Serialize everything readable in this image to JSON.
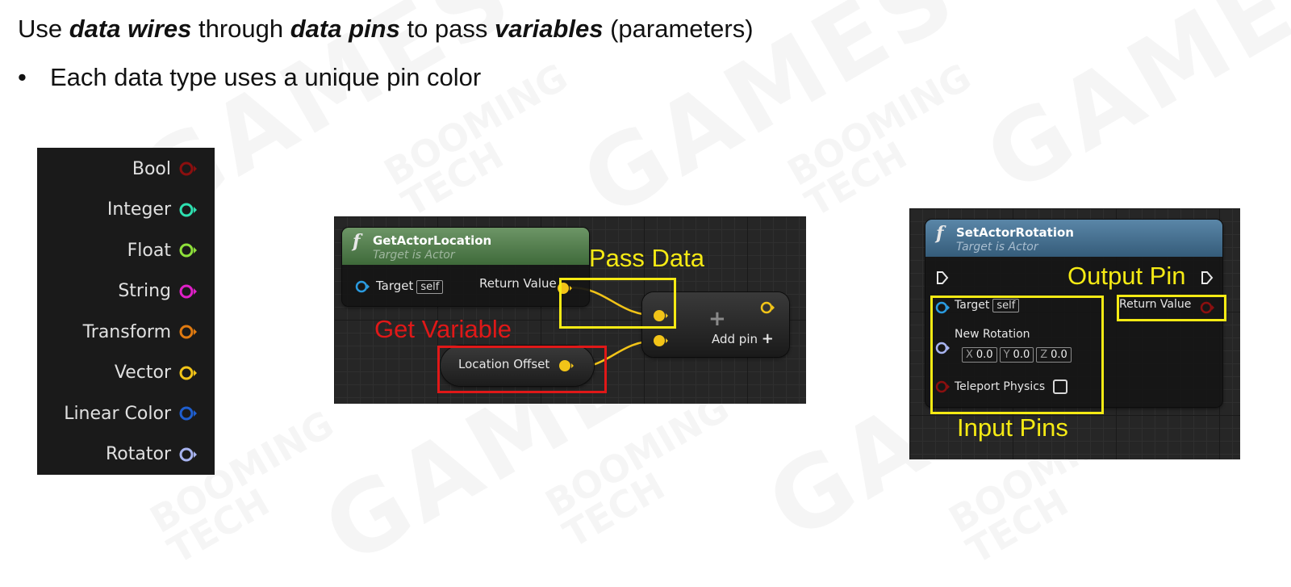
{
  "header": {
    "t1": "Use ",
    "t2": "data wires",
    "t3": " through ",
    "t4": "data pins",
    "t5": " to pass ",
    "t6": "variables",
    "t7": " (parameters)",
    "bullet_mark": "•",
    "bullet": "Each data type uses a unique pin color"
  },
  "pin_types": [
    {
      "label": "Bool",
      "color": "#8b0f0f"
    },
    {
      "label": "Integer",
      "color": "#2ee0b0"
    },
    {
      "label": "Float",
      "color": "#8ee03a"
    },
    {
      "label": "String",
      "color": "#e020c8"
    },
    {
      "label": "Transform",
      "color": "#e07a10"
    },
    {
      "label": "Vector",
      "color": "#f2c418"
    },
    {
      "label": "Linear Color",
      "color": "#1f5fd0"
    },
    {
      "label": "Rotator",
      "color": "#a8b4f0"
    }
  ],
  "get_node": {
    "title": "GetActorLocation",
    "subtitle": "Target is Actor",
    "fx": "f",
    "target_label": "Target",
    "self_label": "self",
    "return_label": "Return Value",
    "header_color": "#4f7d4a"
  },
  "var_node": {
    "label": "Location Offset"
  },
  "add_node": {
    "label": "Add pin",
    "plus": "+"
  },
  "set_node": {
    "title": "SetActorRotation",
    "subtitle": "Target is Actor",
    "fx": "f",
    "target_label": "Target",
    "self_label": "self",
    "new_rotation_label": "New Rotation",
    "x_axis": "X",
    "x_val": "0.0",
    "y_axis": "Y",
    "y_val": "0.0",
    "z_axis": "Z",
    "z_val": "0.0",
    "teleport_label": "Teleport Physics",
    "return_label": "Return Value",
    "header_color": "#3e6a8c"
  },
  "annotations": {
    "pass_data": "Pass Data",
    "get_variable": "Get Variable",
    "output_pin": "Output Pin",
    "input_pins": "Input Pins",
    "yellow": "#f5ea14",
    "red": "#e01818"
  },
  "watermarks": {
    "brand": "GAMES",
    "studio": "BOOMING TECH"
  }
}
